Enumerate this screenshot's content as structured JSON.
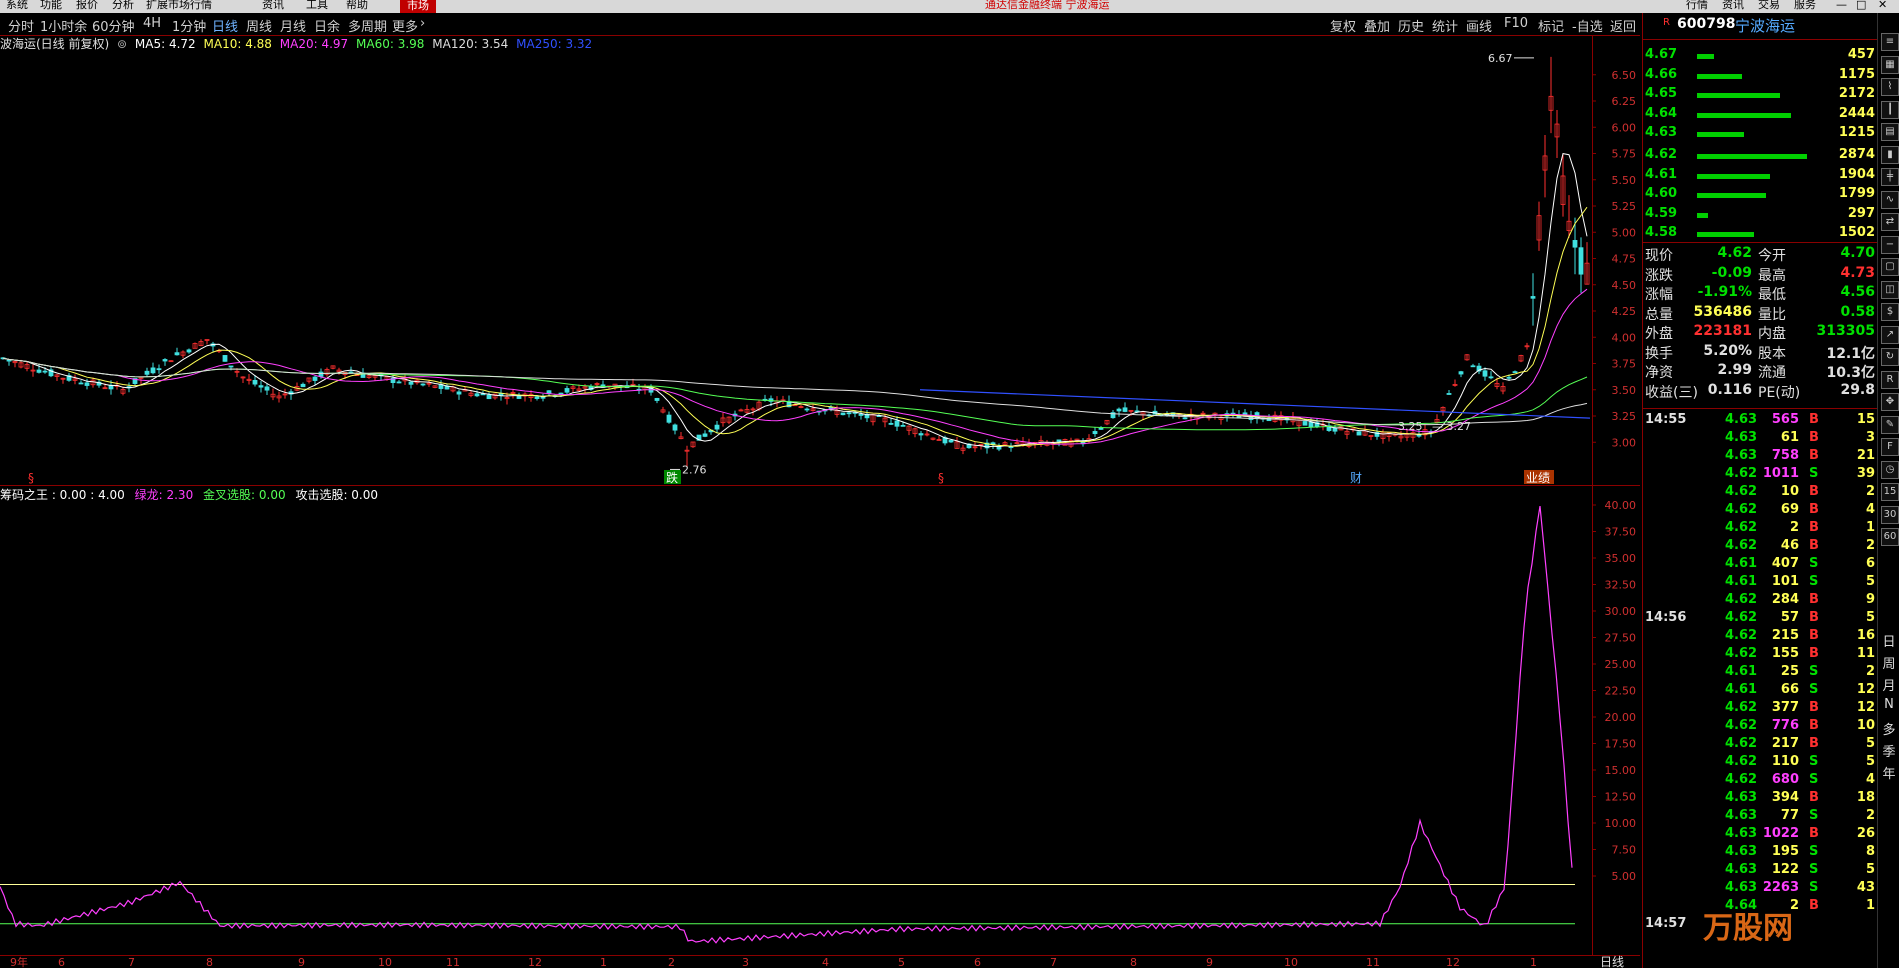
{
  "menubar": {
    "items": [
      "系统",
      "功能",
      "报价",
      "分析",
      "扩展市场行情",
      "资讯",
      "工具",
      "帮助"
    ],
    "market_tab": "市场",
    "window_title": "通达信金融终端 宁波海运",
    "right_buttons": [
      "行情",
      "资讯",
      "交易",
      "服务"
    ]
  },
  "periods": {
    "items": [
      "分时",
      "1小时余",
      "60分钟",
      "4H",
      "1分钟",
      "日线",
      "周线",
      "月线",
      "日余",
      "多周期",
      "更多"
    ],
    "active": "日线"
  },
  "top_tools": {
    "items": [
      "复权",
      "叠加",
      "历史",
      "统计",
      "画线",
      "F10",
      "标记",
      "-自选",
      "返回"
    ]
  },
  "stock": {
    "code": "600798",
    "name": "宁波海运",
    "flag": "R"
  },
  "ma_line": {
    "title": "波海运(日线 前复权)",
    "items": [
      {
        "label": "MA5: 4.72",
        "color": "#ffffff"
      },
      {
        "label": "MA10: 4.88",
        "color": "#ffff55"
      },
      {
        "label": "MA20: 4.97",
        "color": "#ff40ff"
      },
      {
        "label": "MA60: 3.98",
        "color": "#55ff55"
      },
      {
        "label": "MA120: 3.54",
        "color": "#dddddd"
      },
      {
        "label": "MA250: 3.32",
        "color": "#3050ff"
      }
    ]
  },
  "indicator_line": {
    "items": [
      {
        "label": "筹码之王 : 0.00 : 4.00",
        "color": "#ffffff"
      },
      {
        "label": "绿龙: 2.30",
        "color": "#ff40ff"
      },
      {
        "label": "金叉选股: 0.00",
        "color": "#55ff55"
      },
      {
        "label": "攻击选股: 0.00",
        "color": "#ffffff"
      }
    ]
  },
  "price_chart": {
    "y_ticks": [
      "6.50",
      "6.25",
      "6.00",
      "5.75",
      "5.50",
      "5.25",
      "5.00",
      "4.75",
      "4.50",
      "4.25",
      "4.00",
      "3.75",
      "3.50",
      "3.25",
      "3.00"
    ],
    "high_label": "6.67",
    "low_label": "2.76",
    "mid_labels": [
      "3.25",
      "3.27"
    ],
    "event_markers": [
      "§",
      "跌",
      "§",
      "财",
      "业绩"
    ]
  },
  "indicator_chart": {
    "y_ticks": [
      "40.00",
      "37.50",
      "35.00",
      "32.50",
      "30.00",
      "27.50",
      "25.00",
      "22.50",
      "20.00",
      "17.50",
      "15.00",
      "12.50",
      "10.00",
      "7.50",
      "5.00"
    ],
    "peak_value": 40
  },
  "x_axis": {
    "labels": [
      "9年",
      "6",
      "7",
      "8",
      "9",
      "10",
      "11",
      "12",
      "1",
      "2",
      "3",
      "4",
      "5",
      "6",
      "7",
      "8",
      "9",
      "10",
      "11",
      "12",
      "1"
    ],
    "period_label": "日线"
  },
  "order_book": {
    "asks": [
      {
        "price": "4.67",
        "vol": "457"
      },
      {
        "price": "4.66",
        "vol": "1175"
      },
      {
        "price": "4.65",
        "vol": "2172"
      },
      {
        "price": "4.64",
        "vol": "2444"
      },
      {
        "price": "4.63",
        "vol": "1215"
      }
    ],
    "bids": [
      {
        "price": "4.62",
        "vol": "2874"
      },
      {
        "price": "4.61",
        "vol": "1904"
      },
      {
        "price": "4.60",
        "vol": "1799"
      },
      {
        "price": "4.59",
        "vol": "297"
      },
      {
        "price": "4.58",
        "vol": "1502"
      }
    ]
  },
  "quote": {
    "rows": [
      {
        "l1": "现价",
        "v1": "4.62",
        "c1": "#00e000",
        "l2": "今开",
        "v2": "4.70",
        "c2": "#00e000"
      },
      {
        "l1": "涨跌",
        "v1": "-0.09",
        "c1": "#00e000",
        "l2": "最高",
        "v2": "4.73",
        "c2": "#ff3030"
      },
      {
        "l1": "涨幅",
        "v1": "-1.91%",
        "c1": "#00e000",
        "l2": "最低",
        "v2": "4.56",
        "c2": "#00e000"
      },
      {
        "l1": "总量",
        "v1": "536486",
        "c1": "#ffff55",
        "l2": "量比",
        "v2": "0.58",
        "c2": "#00e000"
      },
      {
        "l1": "外盘",
        "v1": "223181",
        "c1": "#ff3030",
        "l2": "内盘",
        "v2": "313305",
        "c2": "#00e000"
      },
      {
        "l1": "换手",
        "v1": "5.20%",
        "c1": "#e0e0e0",
        "l2": "股本",
        "v2": "12.1亿",
        "c2": "#e0e0e0"
      },
      {
        "l1": "净资",
        "v1": "2.99",
        "c1": "#e0e0e0",
        "l2": "流通",
        "v2": "10.3亿",
        "c2": "#e0e0e0"
      },
      {
        "l1": "收益(三)",
        "v1": "0.116",
        "c1": "#e0e0e0",
        "l2": "PE(动)",
        "v2": "29.8",
        "c2": "#e0e0e0"
      }
    ]
  },
  "ticks": {
    "groups": [
      {
        "time": "14:55",
        "rows": [
          [
            "4.63",
            "565",
            "B",
            "15"
          ],
          [
            "4.63",
            "61",
            "B",
            "3"
          ],
          [
            "4.63",
            "758",
            "B",
            "21"
          ],
          [
            "4.62",
            "1011",
            "S",
            "39"
          ],
          [
            "4.62",
            "10",
            "B",
            "2"
          ],
          [
            "4.62",
            "69",
            "B",
            "4"
          ],
          [
            "4.62",
            "2",
            "B",
            "1"
          ],
          [
            "4.62",
            "46",
            "B",
            "2"
          ],
          [
            "4.61",
            "407",
            "S",
            "6"
          ],
          [
            "4.61",
            "101",
            "S",
            "5"
          ],
          [
            "4.62",
            "284",
            "B",
            "9"
          ]
        ]
      },
      {
        "time": "14:56",
        "rows": [
          [
            "4.62",
            "57",
            "B",
            "5"
          ],
          [
            "4.62",
            "215",
            "B",
            "16"
          ],
          [
            "4.62",
            "155",
            "B",
            "11"
          ],
          [
            "4.61",
            "25",
            "S",
            "2"
          ],
          [
            "4.61",
            "66",
            "S",
            "12"
          ],
          [
            "4.62",
            "377",
            "B",
            "12"
          ],
          [
            "4.62",
            "776",
            "B",
            "10"
          ],
          [
            "4.62",
            "217",
            "B",
            "5"
          ],
          [
            "4.62",
            "110",
            "S",
            "5"
          ],
          [
            "4.62",
            "680",
            "S",
            "4"
          ],
          [
            "4.63",
            "394",
            "B",
            "18"
          ],
          [
            "4.63",
            "77",
            "S",
            "2"
          ],
          [
            "4.63",
            "1022",
            "B",
            "26"
          ],
          [
            "4.63",
            "195",
            "S",
            "8"
          ],
          [
            "4.63",
            "122",
            "S",
            "5"
          ],
          [
            "4.63",
            "2263",
            "S",
            "43"
          ],
          [
            "4.64",
            "2",
            "B",
            "1"
          ]
        ]
      },
      {
        "time": "14:57",
        "rows": []
      }
    ]
  },
  "side_tools": {
    "chars": [
      "日",
      "周",
      "月",
      "N",
      "多",
      "季",
      "年"
    ]
  },
  "watermark": "万股网"
}
